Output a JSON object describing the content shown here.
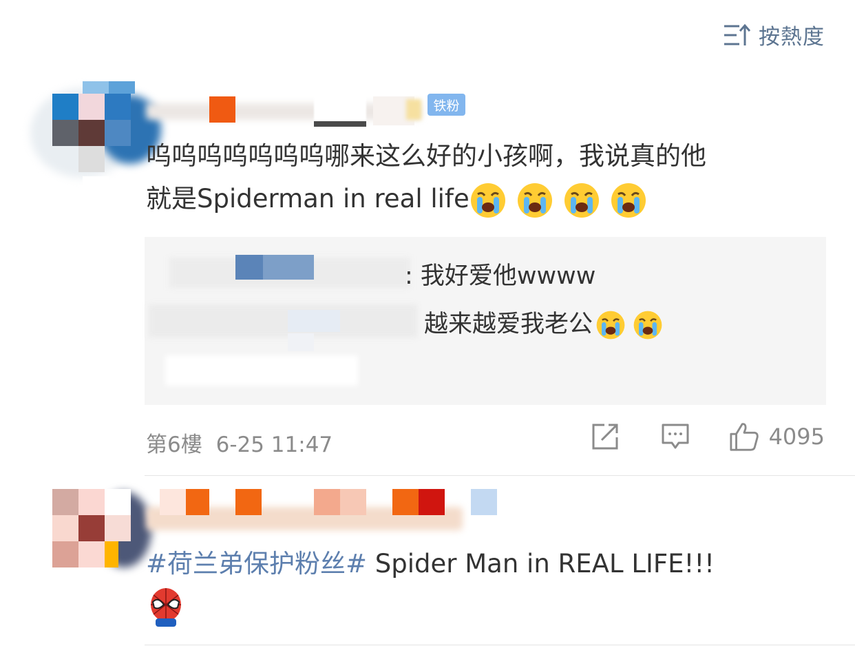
{
  "sort": {
    "label": "按熱度",
    "icon": "sort-icon"
  },
  "comments": [
    {
      "badge": "铁粉",
      "text_line1": "呜呜呜呜呜呜呜哪来这么好的小孩啊，我说真的他",
      "text_line2": "就是Spiderman in real life",
      "emoji": "loudly-crying-face",
      "replies": [
        {
          "text": ": 我好爱他wwww"
        },
        {
          "text": "越来越爱我老公"
        }
      ],
      "floor": "第6樓",
      "time": "6-25 11:47",
      "likes": "4095",
      "actions": [
        "share-icon",
        "comment-icon",
        "like-icon"
      ]
    },
    {
      "hashtag": "#荷兰弟保护粉丝#",
      "text": " Spider Man in REAL LIFE!!!",
      "emoji": "spiderman-face"
    }
  ],
  "colors": {
    "link": "#5d7fae",
    "badge": "#82b6ee",
    "meta": "#8b8b8b",
    "reply_bg": "#f5f5f5"
  }
}
